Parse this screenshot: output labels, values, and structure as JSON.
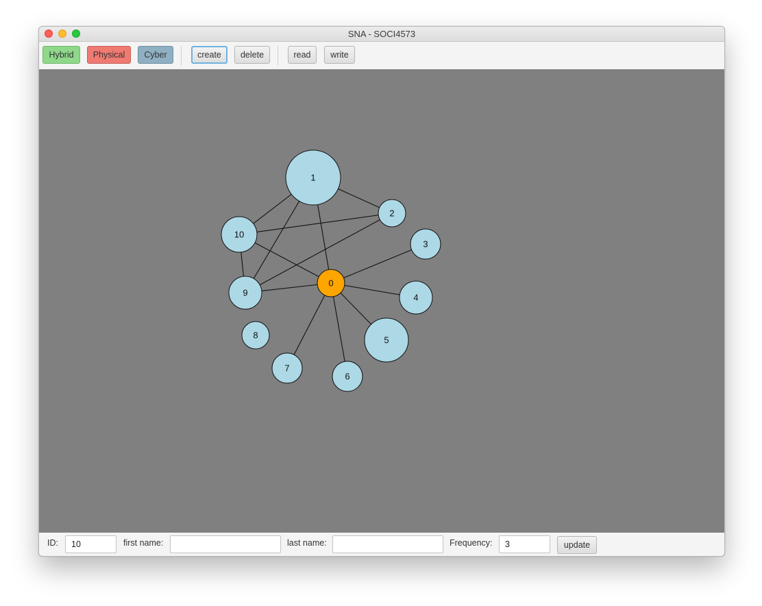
{
  "window": {
    "title": "SNA - SOCI4573"
  },
  "toolbar": {
    "hybrid": "Hybrid",
    "physical": "Physical",
    "cyber": "Cyber",
    "create": "create",
    "delete": "delete",
    "read": "read",
    "write": "write"
  },
  "colors": {
    "hybrid": "#8fd88a",
    "physical": "#ef7a72",
    "cyber": "#8fb0c2",
    "canvas": "#808080",
    "node": "#add8e6",
    "selected_node": "#ffa500"
  },
  "graph": {
    "selected": "0",
    "nodes": [
      {
        "id": "0",
        "label": "0"
      },
      {
        "id": "1",
        "label": "1"
      },
      {
        "id": "2",
        "label": "2"
      },
      {
        "id": "3",
        "label": "3"
      },
      {
        "id": "4",
        "label": "4"
      },
      {
        "id": "5",
        "label": "5"
      },
      {
        "id": "6",
        "label": "6"
      },
      {
        "id": "7",
        "label": "7"
      },
      {
        "id": "8",
        "label": "8"
      },
      {
        "id": "9",
        "label": "9"
      },
      {
        "id": "10",
        "label": "10"
      }
    ],
    "edges": [
      [
        "1",
        "10"
      ],
      [
        "1",
        "2"
      ],
      [
        "1",
        "9"
      ],
      [
        "1",
        "0"
      ],
      [
        "10",
        "2"
      ],
      [
        "10",
        "9"
      ],
      [
        "10",
        "0"
      ],
      [
        "2",
        "9"
      ],
      [
        "9",
        "0"
      ],
      [
        "0",
        "3"
      ],
      [
        "0",
        "4"
      ],
      [
        "0",
        "5"
      ],
      [
        "0",
        "6"
      ],
      [
        "0",
        "7"
      ]
    ]
  },
  "form": {
    "id_label": "ID:",
    "id_value": "10",
    "first_name_label": "first name:",
    "first_name_value": "",
    "last_name_label": "last name:",
    "last_name_value": "",
    "frequency_label": "Frequency:",
    "frequency_value": "3",
    "update": "update"
  }
}
